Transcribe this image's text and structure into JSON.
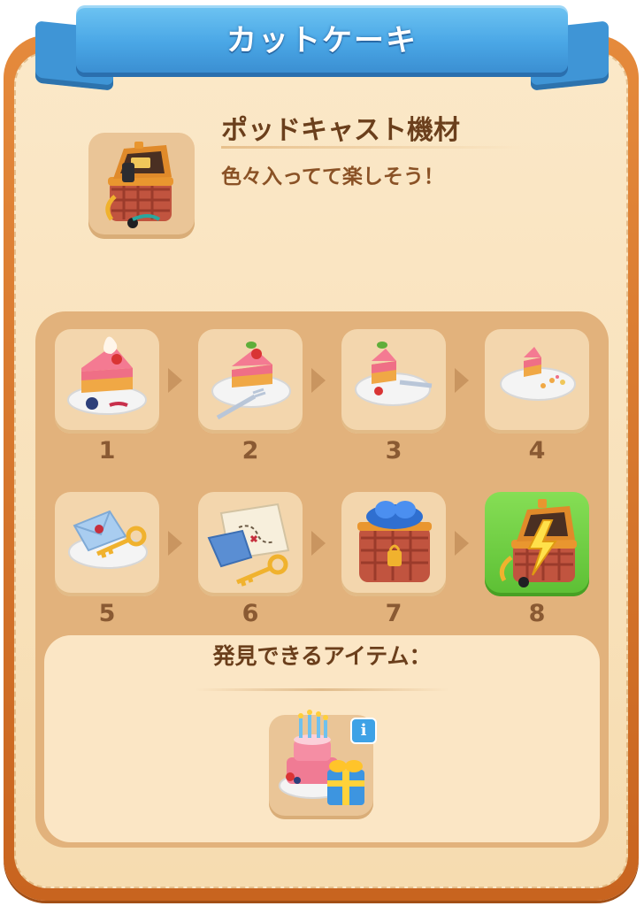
{
  "header": {
    "title": "カットケーキ"
  },
  "item": {
    "name": "ポッドキャスト機材",
    "description": "色々入ってて楽しそう！",
    "icon": "podcast-chest-icon"
  },
  "chain": {
    "items": [
      {
        "level": "1",
        "icon": "whole-cake-slice-icon",
        "selected": false
      },
      {
        "level": "2",
        "icon": "cake-slice-fork-icon",
        "selected": false
      },
      {
        "level": "3",
        "icon": "half-eaten-cake-icon",
        "selected": false
      },
      {
        "level": "4",
        "icon": "cake-crumbs-icon",
        "selected": false
      },
      {
        "level": "5",
        "icon": "letter-key-plate-icon",
        "selected": false
      },
      {
        "level": "6",
        "icon": "treasure-map-key-icon",
        "selected": false
      },
      {
        "level": "7",
        "icon": "locked-basket-chest-icon",
        "selected": false
      },
      {
        "level": "8",
        "icon": "lightning-chest-icon",
        "selected": true
      }
    ],
    "active_color": "#6fcf45"
  },
  "discover": {
    "title": "発見できるアイテム：",
    "item_icon": "birthday-cake-gift-icon",
    "info_label": "i"
  }
}
